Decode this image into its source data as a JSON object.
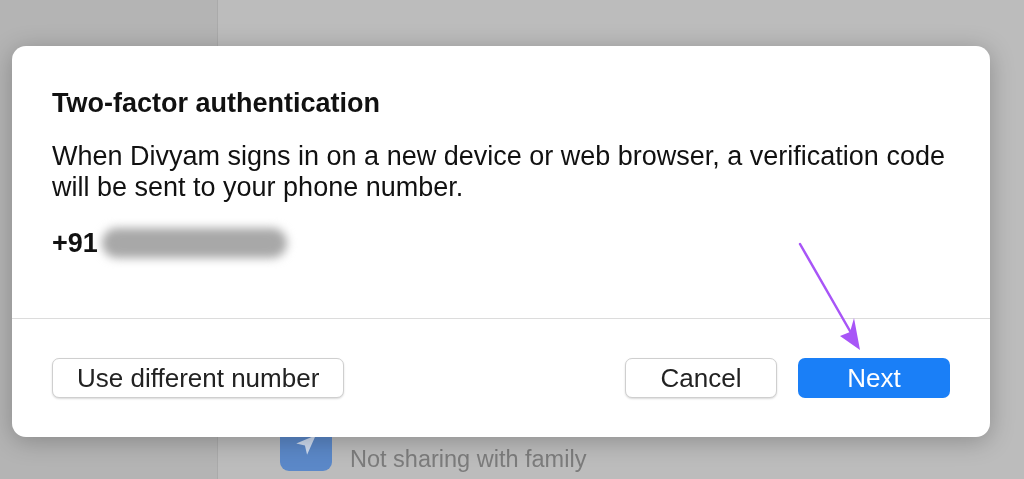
{
  "background": {
    "location_row": {
      "subtitle": "Not sharing with family"
    }
  },
  "dialog": {
    "title": "Two-factor authentication",
    "message": "When Divyam signs in on a new device or web browser, a verification code will be sent to your phone number.",
    "phone": {
      "prefix": "+91",
      "redacted": true
    },
    "buttons": [
      {
        "label": "Use different number",
        "kind": "secondary"
      },
      {
        "label": "Cancel",
        "kind": "secondary"
      },
      {
        "label": "Next",
        "kind": "primary"
      }
    ]
  },
  "annotation": {
    "kind": "arrow"
  }
}
